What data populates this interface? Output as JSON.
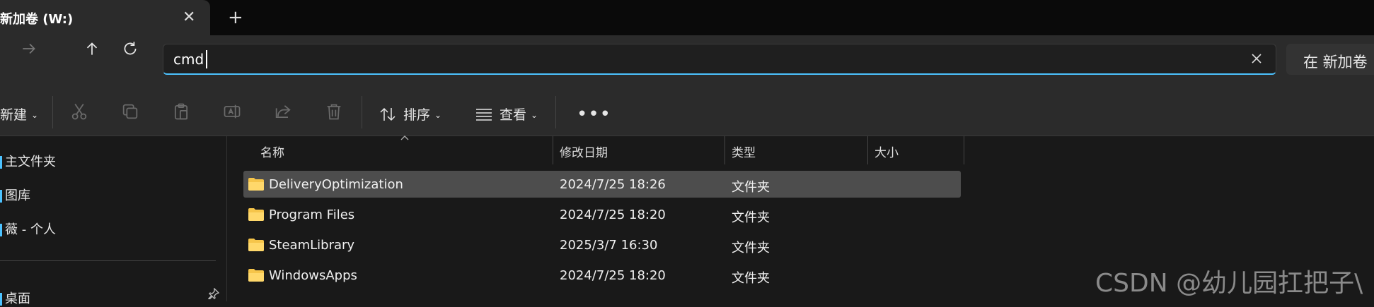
{
  "tab": {
    "title": "新加卷 (W:)"
  },
  "address_bar": {
    "value": "cmd"
  },
  "search": {
    "placeholder": "在 新加卷"
  },
  "toolbar": {
    "new_label": "新建",
    "sort_label": "排序",
    "view_label": "查看"
  },
  "sidebar": {
    "items": [
      {
        "label": "主文件夹"
      },
      {
        "label": "图库"
      },
      {
        "label": "薇 - 个人"
      },
      {
        "label": "桌面"
      }
    ]
  },
  "columns": {
    "name": "名称",
    "modified": "修改日期",
    "type": "类型",
    "size": "大小"
  },
  "files": [
    {
      "name": "DeliveryOptimization",
      "modified": "2024/7/25 18:26",
      "type": "文件夹",
      "selected": true
    },
    {
      "name": "Program Files",
      "modified": "2024/7/25 18:20",
      "type": "文件夹",
      "selected": false
    },
    {
      "name": "SteamLibrary",
      "modified": "2025/3/7 16:30",
      "type": "文件夹",
      "selected": false
    },
    {
      "name": "WindowsApps",
      "modified": "2024/7/25 18:20",
      "type": "文件夹",
      "selected": false
    }
  ],
  "watermark": "CSDN @幼儿园扛把子\\",
  "colors": {
    "accent": "#4cc2ff",
    "folder": "#f6c54a",
    "selection": "#4d4d4d"
  },
  "icons": [
    "close-icon",
    "plus-icon",
    "arrow-right-icon",
    "arrow-up-icon",
    "refresh-icon",
    "cut-icon",
    "copy-icon",
    "paste-icon",
    "rename-icon",
    "share-icon",
    "delete-icon",
    "sort-icon",
    "view-icon",
    "more-icon",
    "folder-icon",
    "pin-icon"
  ]
}
